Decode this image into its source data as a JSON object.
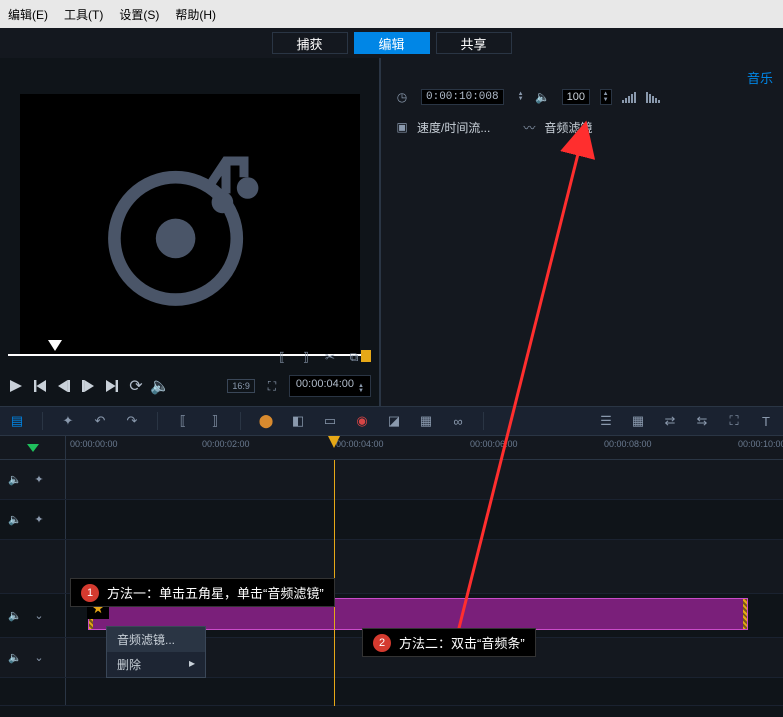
{
  "menubar": {
    "items": [
      "编辑(E)",
      "工具(T)",
      "设置(S)",
      "帮助(H)"
    ]
  },
  "mode_tabs": {
    "items": [
      "捕获",
      "编辑",
      "共享"
    ],
    "active_index": 1
  },
  "preview": {
    "timecode": "00:00:04:00",
    "aspect_badge": "16:9"
  },
  "options": {
    "link_label": "音乐",
    "duration": "0:00:10:008",
    "volume": "100",
    "speed_label": "速度/时间流...",
    "filter_label": "音频滤镜"
  },
  "ruler": {
    "ticks": [
      "00:00:00:00",
      "00:00:02:00",
      "00:00:04:00",
      "00:00:06:00",
      "00:00:08:00",
      "00:00:10:00"
    ]
  },
  "context_menu": {
    "items": [
      "音频滤镜...",
      "删除"
    ]
  },
  "callouts": {
    "c1": {
      "num": "1",
      "text": "方法一：单击五角星，单击“音频滤镜”"
    },
    "c2": {
      "num": "2",
      "text": "方法二：双击“音频条”"
    }
  }
}
